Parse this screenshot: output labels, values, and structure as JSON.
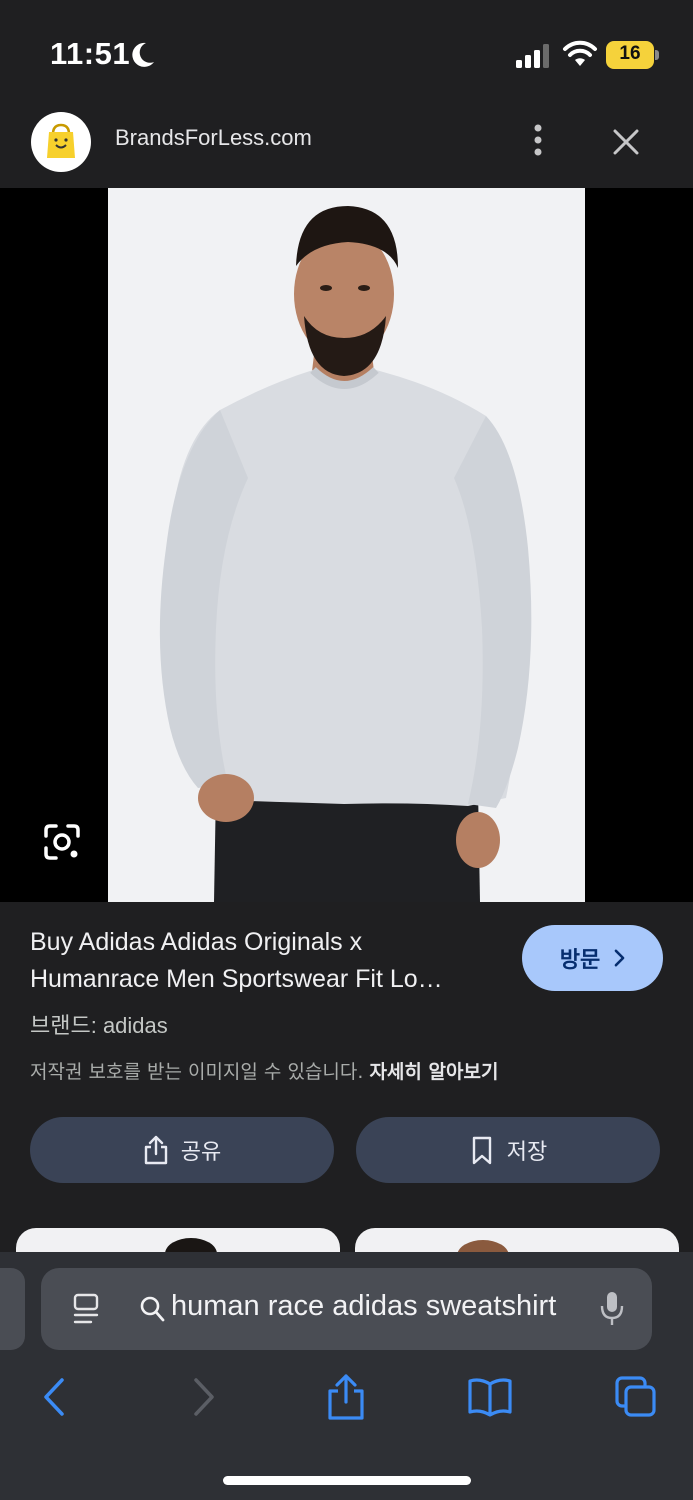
{
  "status_bar": {
    "time": "11:51",
    "battery": "16"
  },
  "site_header": {
    "site_name": "BrandsForLess.com"
  },
  "result": {
    "title_line1": "Buy Adidas Adidas Originals x",
    "title_line2": "Humanrace Men Sportswear Fit Lo…",
    "visit_label": "방문",
    "brand": "브랜드: adidas",
    "copyright_notice": "저작권 보호를 받는 이미지일 수 있습니다.",
    "learn_more": "자세히 알아보기",
    "share_label": "공유",
    "save_label": "저장"
  },
  "browser": {
    "url_query": "human race adidas sweatshirt"
  },
  "colors": {
    "visit_button": "#a8c8fb",
    "pill_button": "#3a4356",
    "battery": "#f5d23b",
    "nav_accent": "#3b8bf5"
  },
  "icons": [
    "moon-icon",
    "signal-icon",
    "wifi-icon",
    "battery-icon",
    "shopping-bag-icon",
    "more-vert-icon",
    "close-icon",
    "lens-icon",
    "chevron-right-icon",
    "share-icon",
    "bookmark-icon",
    "reader-icon",
    "search-icon",
    "mic-icon",
    "back-icon",
    "forward-icon",
    "share-icon",
    "bookmarks-icon",
    "tabs-icon"
  ]
}
